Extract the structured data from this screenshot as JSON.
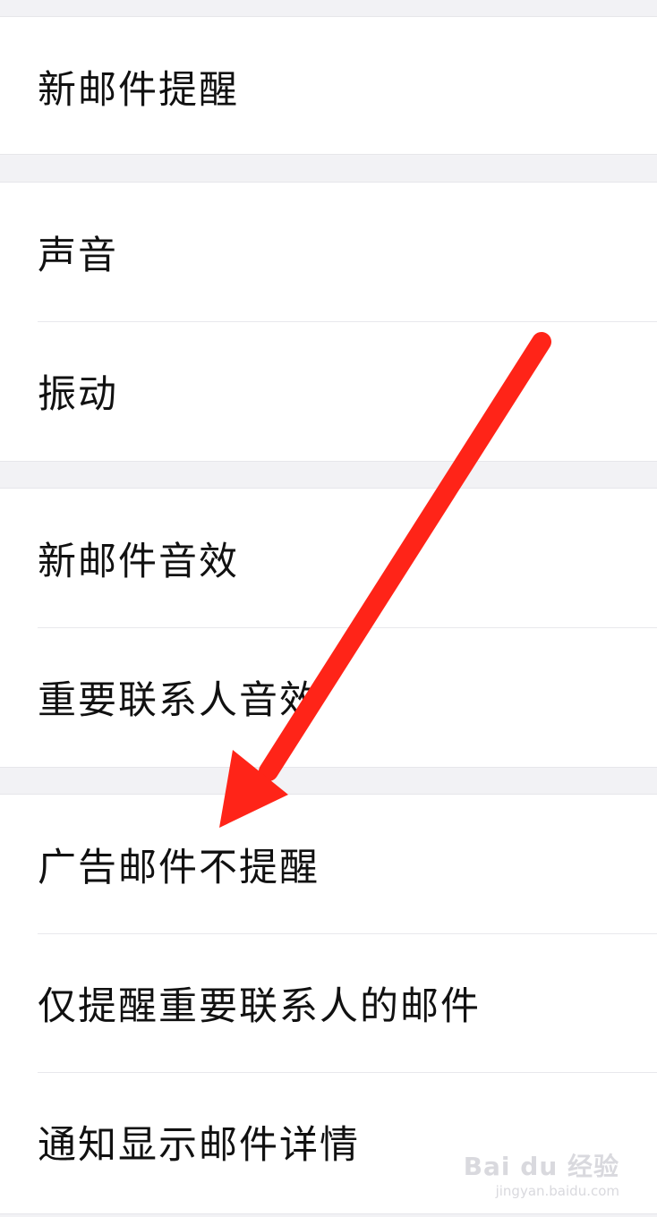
{
  "groups": [
    {
      "items": [
        {
          "label": "新邮件提醒"
        }
      ]
    },
    {
      "items": [
        {
          "label": "声音"
        },
        {
          "label": "振动"
        }
      ]
    },
    {
      "items": [
        {
          "label": "新邮件音效"
        },
        {
          "label": "重要联系人音效"
        }
      ]
    },
    {
      "items": [
        {
          "label": "广告邮件不提醒"
        },
        {
          "label": "仅提醒重要联系人的邮件"
        },
        {
          "label": "通知显示邮件详情"
        }
      ]
    }
  ],
  "annotation": {
    "arrow_color": "#ff2418"
  },
  "watermark": {
    "brand": "Bai du 经验",
    "url": "jingyan.baidu.com"
  }
}
